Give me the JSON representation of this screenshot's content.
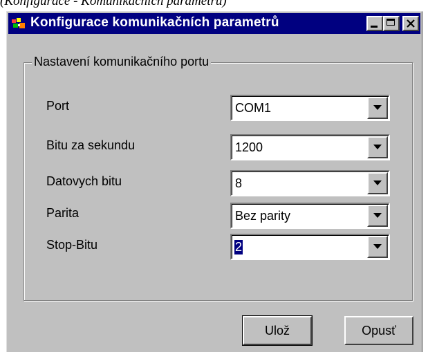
{
  "caption": "(Konfigurace - Komunikačních parametrů)",
  "window": {
    "title": "Konfigurace komunikačních parametrů",
    "icon": "app-icon"
  },
  "group": {
    "legend": "Nastavení komunikačního portu"
  },
  "fields": [
    {
      "label": "Port",
      "value": "COM1"
    },
    {
      "label": "Bitu za sekundu",
      "value": "1200"
    },
    {
      "label": "Datovych bitu",
      "value": "8"
    },
    {
      "label": "Parita",
      "value": "Bez parity"
    },
    {
      "label": "Stop-Bitu",
      "value": "2"
    }
  ],
  "buttons": {
    "save": "Ulož",
    "cancel": "Opusť"
  },
  "colors": {
    "titlebar": "#000080",
    "face": "#c0c0c0",
    "selection": "#000080"
  }
}
